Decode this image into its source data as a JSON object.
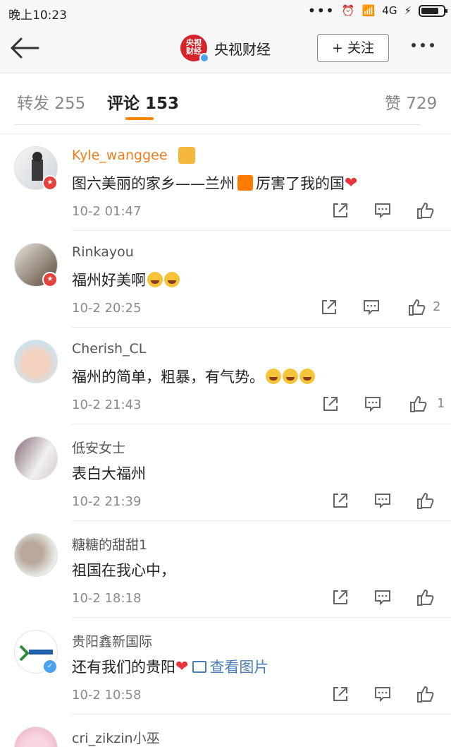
{
  "status": {
    "time": "晚上10:23",
    "network": "4G"
  },
  "nav": {
    "account_name": "央视财经",
    "avatar_text": "央视财经",
    "follow_label": "+ 关注"
  },
  "tabs": [
    {
      "label": "转发 255"
    },
    {
      "label": "评论 153"
    },
    {
      "label": "赞 729"
    }
  ],
  "comments": [
    {
      "user": "Kyle_wanggee",
      "text": "图六美丽的家乡——兰州",
      "text2": "厉害了我的国",
      "time": "10-2 01:47",
      "likes": ""
    },
    {
      "user": "Rinkayou",
      "text": "福州好美啊",
      "time": "10-2 20:25",
      "likes": "2"
    },
    {
      "user": "Cherish_CL",
      "text": "福州的简单，粗暴，有气势。",
      "time": "10-2 21:43",
      "likes": "1"
    },
    {
      "user": "低安女士",
      "text": "表白大福州",
      "time": "10-2 21:39",
      "likes": ""
    },
    {
      "user": "糖糖的甜甜1",
      "text": "祖国在我心中，",
      "time": "10-2 18:18",
      "likes": ""
    },
    {
      "user": "贵阳鑫新国际",
      "text": "还有我们的贵阳",
      "link": "查看图片",
      "time": "10-2 10:58",
      "likes": ""
    },
    {
      "user": "cri_zikzin小巫",
      "text": "",
      "time": "",
      "likes": ""
    }
  ],
  "colors": {
    "accent": "#ff8200",
    "vip_name": "#f07c1d",
    "link": "#4a7eb6"
  }
}
